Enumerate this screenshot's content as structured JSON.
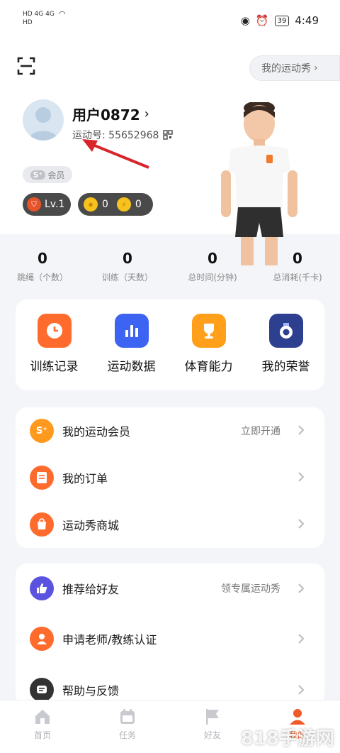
{
  "status": {
    "left_top": "HD 4G 4G",
    "left_bottom": "HD",
    "battery": "39",
    "time": "4:49"
  },
  "header": {
    "show_button": "我的运动秀",
    "username": "用户0872",
    "uid_label": "运动号: 55652968",
    "vip_tag": "会员",
    "vip_logo": "S⁺",
    "level": "Lv.1",
    "coin_a": "0",
    "coin_b": "0"
  },
  "stats": [
    {
      "value": "0",
      "label": "跳绳（个数）"
    },
    {
      "value": "0",
      "label": "训练（天数）"
    },
    {
      "value": "0",
      "label": "总时间(分钟)"
    },
    {
      "value": "0",
      "label": "总消耗(千卡)"
    }
  ],
  "quick": [
    {
      "label": "训练记录",
      "icon": "clock-icon",
      "color": "#ff6b2c"
    },
    {
      "label": "运动数据",
      "icon": "bar-chart-icon",
      "color": "#3d63f2"
    },
    {
      "label": "体育能力",
      "icon": "trophy-icon",
      "color": "#ff9f1a"
    },
    {
      "label": "我的荣誉",
      "icon": "medal-icon",
      "color": "#2d3f8f"
    }
  ],
  "menu1": [
    {
      "label": "我的运动会员",
      "hint": "立即开通",
      "icon": "vip-icon",
      "color": "#ff9a1f"
    },
    {
      "label": "我的订单",
      "hint": "",
      "icon": "order-icon",
      "color": "#ff6b2c"
    },
    {
      "label": "运动秀商城",
      "hint": "",
      "icon": "shop-icon",
      "color": "#ff6b2c"
    }
  ],
  "menu2": [
    {
      "label": "推荐给好友",
      "hint": "领专属运动秀",
      "icon": "thumbs-up-icon",
      "color": "#5b52e0"
    },
    {
      "label": "申请老师/教练认证",
      "hint": "",
      "icon": "certificate-icon",
      "color": "#ff6b2c"
    },
    {
      "label": "帮助与反馈",
      "hint": "",
      "icon": "feedback-icon",
      "color": "#333333"
    }
  ],
  "tabs": [
    {
      "label": "首页",
      "icon": "home-icon"
    },
    {
      "label": "任务",
      "icon": "calendar-icon"
    },
    {
      "label": "好友",
      "icon": "flag-icon"
    },
    {
      "label": "我的",
      "icon": "profile-icon"
    }
  ],
  "watermark": "818手游网",
  "colors": {
    "accent": "#f05a28",
    "tab_inactive": "#c8cad0"
  }
}
